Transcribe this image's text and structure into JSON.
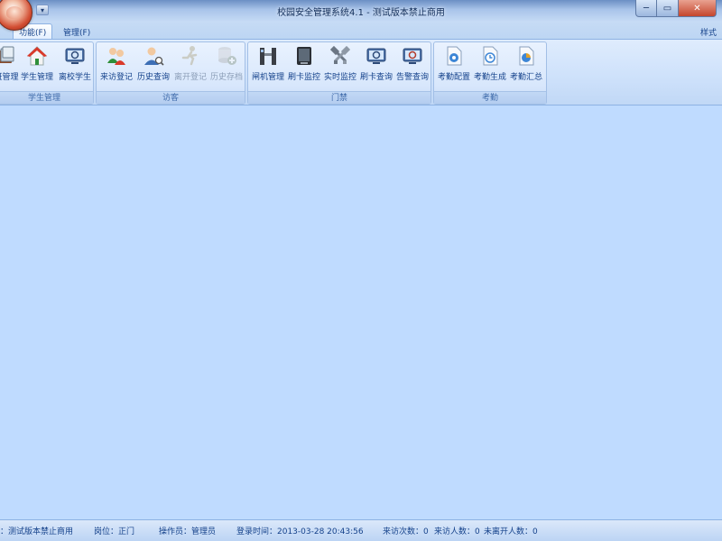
{
  "window": {
    "title": "校园安全管理系统4.1 - 测试版本禁止商用",
    "min_glyph": "─",
    "max_glyph": "▭",
    "close_glyph": "✕"
  },
  "qat": {
    "down_glyph": "▾"
  },
  "tabs": [
    {
      "label": "功能(F)",
      "active": true
    },
    {
      "label": "管理(F)",
      "active": false
    }
  ],
  "style_label": "样式",
  "ribbon": {
    "groups": [
      {
        "label": "学生管理",
        "buttons": [
          {
            "label": "班管理",
            "icon": "class-book-icon",
            "disabled": false
          },
          {
            "label": "学生管理",
            "icon": "house-icon",
            "disabled": false
          },
          {
            "label": "离校学生",
            "icon": "monitor-search-icon",
            "disabled": false
          }
        ]
      },
      {
        "label": "访客",
        "buttons": [
          {
            "label": "来访登记",
            "icon": "users-icon",
            "disabled": false
          },
          {
            "label": "历史查询",
            "icon": "user-search-icon",
            "disabled": false
          },
          {
            "label": "离开登记",
            "icon": "running-man-icon",
            "disabled": true
          },
          {
            "label": "历史存档",
            "icon": "database-add-icon",
            "disabled": true
          }
        ]
      },
      {
        "label": "门禁",
        "buttons": [
          {
            "label": "闸机管理",
            "icon": "gate-icon",
            "disabled": false
          },
          {
            "label": "刷卡监控",
            "icon": "card-reader-icon",
            "disabled": false
          },
          {
            "label": "实时监控",
            "icon": "tools-icon",
            "disabled": false
          },
          {
            "label": "刷卡查询",
            "icon": "monitor-search-icon",
            "disabled": false
          },
          {
            "label": "告警查询",
            "icon": "monitor-alarm-icon",
            "disabled": false
          }
        ]
      },
      {
        "label": "考勤",
        "buttons": [
          {
            "label": "考勤配置",
            "icon": "doc-gear-icon",
            "disabled": false
          },
          {
            "label": "考勤生成",
            "icon": "doc-clock-icon",
            "disabled": false
          },
          {
            "label": "考勤汇总",
            "icon": "doc-chart-icon",
            "disabled": false
          }
        ]
      }
    ]
  },
  "status": {
    "version": "：测试版本禁止商用",
    "post": "岗位：正门",
    "operator": "操作员：管理员",
    "login_time": "登录时间：2013-03-28 20:43:56",
    "visit_count": "来访次数：0",
    "visitor_count": "来访人数：0",
    "not_left_count": "未离开人数：0"
  },
  "colors": {
    "client_bg": "#bfdbff",
    "ribbon_text": "#15428b",
    "group_label": "#3e6aaa",
    "close_red": "#c4452c"
  }
}
